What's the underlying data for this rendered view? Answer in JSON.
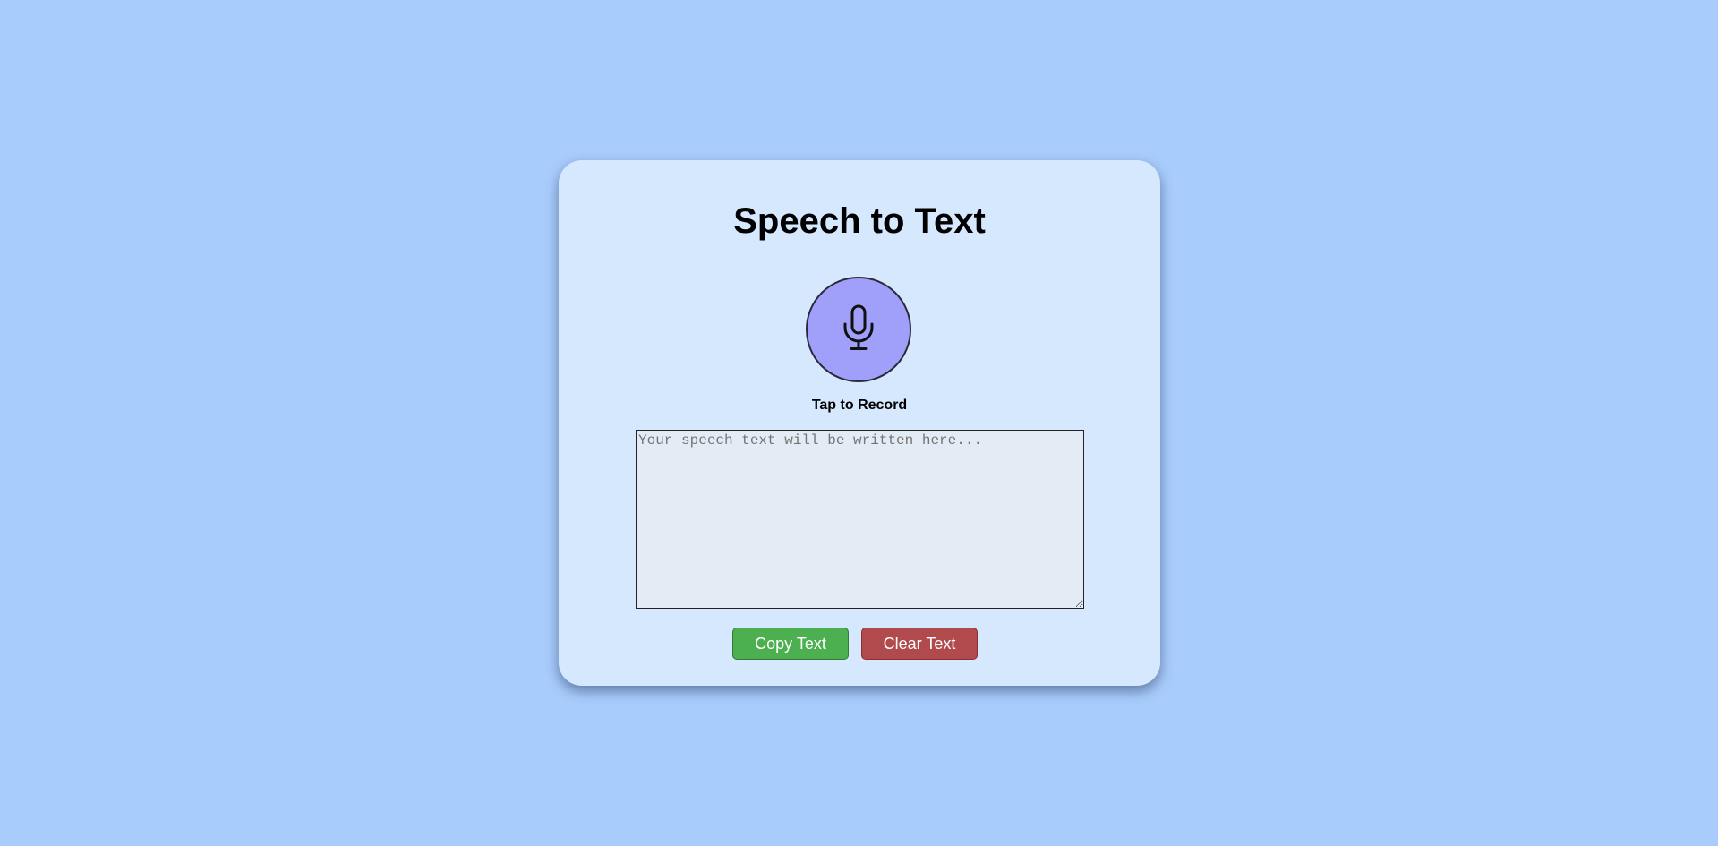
{
  "card": {
    "title": "Speech to Text",
    "record_label": "Tap to Record",
    "textarea": {
      "value": "",
      "placeholder": "Your speech text will be written here..."
    },
    "buttons": {
      "copy_label": "Copy Text",
      "clear_label": "Clear Text"
    }
  },
  "icons": {
    "mic": "microphone-icon"
  },
  "colors": {
    "background": "#a8ccfc",
    "card": "#d6e8fe",
    "mic_button": "#a0a0fb",
    "copy_button": "#4caf50",
    "clear_button": "#b04a4c",
    "textarea": "#e3ebf4"
  }
}
